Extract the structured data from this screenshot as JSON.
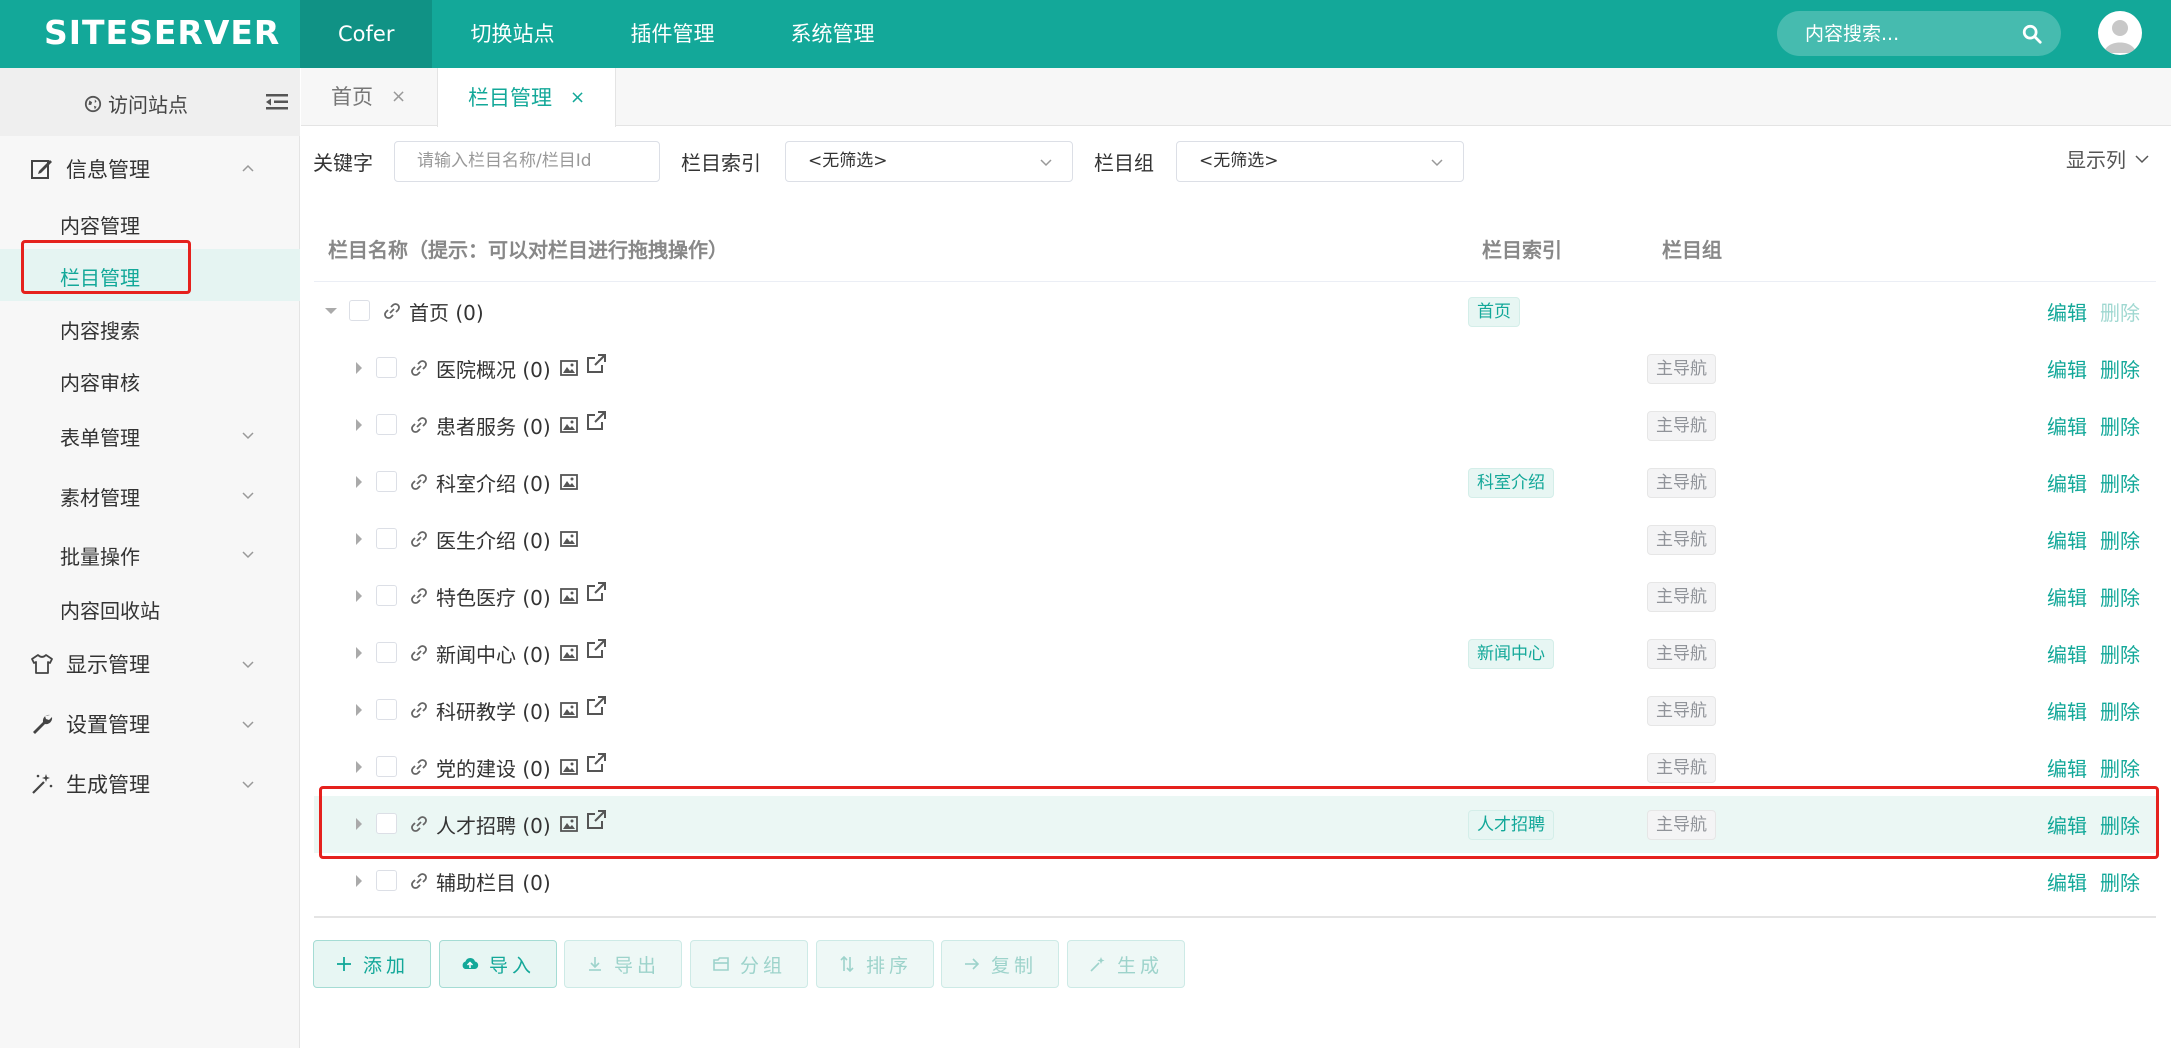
{
  "app": {
    "logo": "SITESERVER",
    "nav": [
      "Cofer",
      "切换站点",
      "插件管理",
      "系统管理"
    ],
    "search_placeholder": "内容搜索..."
  },
  "sidebar": {
    "visit": "访问站点",
    "groups": {
      "info": "信息管理",
      "display": "显示管理",
      "settings": "设置管理",
      "generate": "生成管理"
    },
    "subitems": [
      "内容管理",
      "栏目管理",
      "内容搜索",
      "内容审核",
      "表单管理",
      "素材管理",
      "批量操作",
      "内容回收站"
    ]
  },
  "tabs": [
    {
      "label": "首页",
      "close": "×"
    },
    {
      "label": "栏目管理",
      "close": "×"
    }
  ],
  "filters": {
    "keyword_label": "关键字",
    "keyword_placeholder": "请输入栏目名称/栏目Id",
    "index_label": "栏目索引",
    "index_value": "<无筛选>",
    "group_label": "栏目组",
    "group_value": "<无筛选>",
    "show_columns": "显示列"
  },
  "table": {
    "headers": {
      "name": "栏目名称（提示：可以对栏目进行拖拽操作）",
      "index": "栏目索引",
      "group": "栏目组"
    },
    "edit": "编辑",
    "delete": "删除",
    "rows": [
      {
        "name": "首页 (0)",
        "index": "首页",
        "group": ""
      },
      {
        "name": "医院概况 (0)",
        "index": "",
        "group": "主导航"
      },
      {
        "name": "患者服务 (0)",
        "index": "",
        "group": "主导航"
      },
      {
        "name": "科室介绍 (0)",
        "index": "科室介绍",
        "group": "主导航"
      },
      {
        "name": "医生介绍 (0)",
        "index": "",
        "group": "主导航"
      },
      {
        "name": "特色医疗 (0)",
        "index": "",
        "group": "主导航"
      },
      {
        "name": "新闻中心 (0)",
        "index": "新闻中心",
        "group": "主导航"
      },
      {
        "name": "科研教学 (0)",
        "index": "",
        "group": "主导航"
      },
      {
        "name": "党的建设 (0)",
        "index": "",
        "group": "主导航"
      },
      {
        "name": "人才招聘 (0)",
        "index": "人才招聘",
        "group": "主导航"
      },
      {
        "name": "辅助栏目 (0)",
        "index": "",
        "group": ""
      }
    ]
  },
  "actions": [
    "添加",
    "导入",
    "导出",
    "分组",
    "排序",
    "复制",
    "生成"
  ],
  "colors": {
    "brand": "#13a899",
    "highlight_row": "#ebf7f4",
    "annotation_red": "#e5211d"
  }
}
